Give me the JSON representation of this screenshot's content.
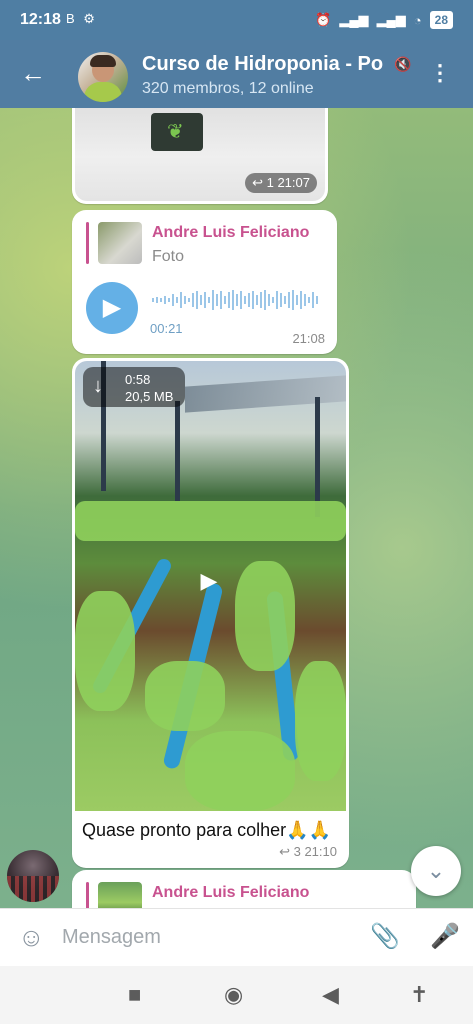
{
  "status_bar": {
    "time": "12:18",
    "left_icons": [
      "B",
      "⚙"
    ],
    "battery": "28"
  },
  "header": {
    "back_icon": "arrow-left-icon",
    "title": "Curso de Hidroponia - Po",
    "subtitle": "320 membros, 12 online",
    "muted_icon": "muted-icon",
    "menu_icon": "more-vert-icon"
  },
  "messages": {
    "image_msg": {
      "replies": "1",
      "time": "21:07"
    },
    "voice_msg": {
      "reply_name": "Andre Luis Feliciano",
      "reply_type": "Foto",
      "duration": "00:21",
      "time": "21:08"
    },
    "video_msg": {
      "video_length": "0:58",
      "video_size": "20,5 MB",
      "caption": "Quase pronto para colher🙏🙏",
      "replies": "3",
      "time": "21:10"
    },
    "partial_msg": {
      "reply_name": "Andre Luis Feliciano"
    }
  },
  "composer": {
    "placeholder": "Mensagem"
  },
  "colors": {
    "header": "#517da2",
    "accent_name": "#c8528f",
    "play_button": "#64b0e6"
  }
}
